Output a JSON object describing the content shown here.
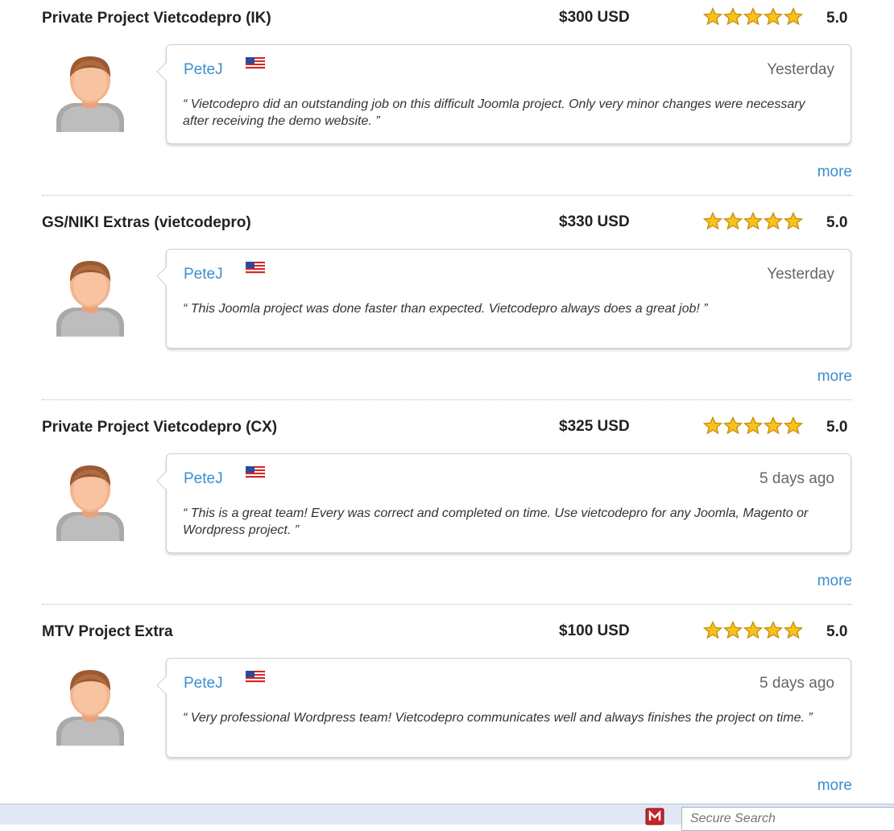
{
  "reviews": [
    {
      "project": "Private Project Vietcodepro (IK)",
      "price": "$300 USD",
      "rating": 5,
      "score": "5.0",
      "reviewer": "PeteJ",
      "flag": "us-flag-icon",
      "date": "Yesterday",
      "comment": "“ Vietcodepro did an outstanding job on this difficult Joomla project. Only very minor changes were necessary after receiving the demo website. ”",
      "more": "more"
    },
    {
      "project": "GS/NIKI Extras (vietcodepro)",
      "price": "$330 USD",
      "rating": 5,
      "score": "5.0",
      "reviewer": "PeteJ",
      "flag": "us-flag-icon",
      "date": "Yesterday",
      "comment": "“ This Joomla project was done faster than expected. Vietcodepro always does a great job! ”",
      "more": "more"
    },
    {
      "project": "Private Project Vietcodepro (CX)",
      "price": "$325 USD",
      "rating": 5,
      "score": "5.0",
      "reviewer": "PeteJ",
      "flag": "us-flag-icon",
      "date": "5 days ago",
      "comment": "“ This is a great team! Every was correct and completed on time. Use vietcodepro for any Joomla, Magento or Wordpress project. ”",
      "more": "more"
    },
    {
      "project": "MTV Project Extra",
      "price": "$100 USD",
      "rating": 5,
      "score": "5.0",
      "reviewer": "PeteJ",
      "flag": "us-flag-icon",
      "date": "5 days ago",
      "comment": "“ Very professional Wordpress team! Vietcodepro communicates well and always finishes the project on time. ”",
      "more": "more"
    }
  ],
  "bottom_bar": {
    "search_placeholder": "Secure Search",
    "shield_icon": "security-shield-icon"
  },
  "colors": {
    "link": "#3b8fd0",
    "star_fill": "#f7c21a",
    "star_outline": "#c98a0c"
  }
}
